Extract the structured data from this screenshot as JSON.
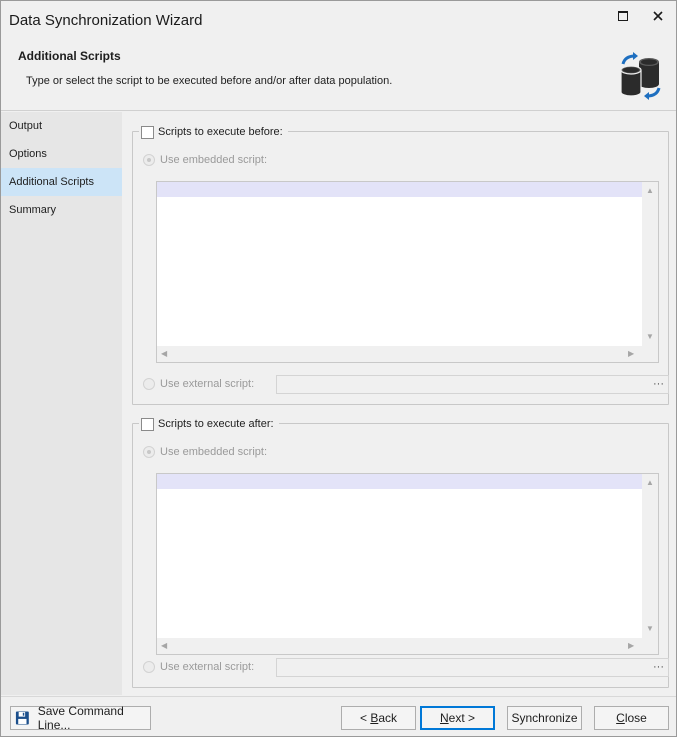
{
  "window": {
    "title": "Data Synchronization Wizard"
  },
  "header": {
    "title": "Additional Scripts",
    "description": "Type or select the script to be executed before and/or after data population."
  },
  "sidebar": {
    "items": [
      {
        "label": "Output",
        "active": false
      },
      {
        "label": "Options",
        "active": false
      },
      {
        "label": "Additional Scripts",
        "active": true
      },
      {
        "label": "Summary",
        "active": false
      }
    ]
  },
  "before_group": {
    "label": "Scripts to execute before:",
    "checked": false,
    "embedded_label": "Use embedded script:",
    "external_label": "Use external script:",
    "external_value": ""
  },
  "after_group": {
    "label": "Scripts to execute after:",
    "checked": false,
    "embedded_label": "Use embedded script:",
    "external_label": "Use external script:",
    "external_value": ""
  },
  "footer": {
    "save_label": "Save Command Line...",
    "back_prefix": "< ",
    "back_key": "B",
    "back_rest": "ack",
    "next_key": "N",
    "next_rest": "ext >",
    "synchronize_label": "Synchronize",
    "close_key": "C",
    "close_rest": "lose"
  },
  "icons": {
    "maximize": "maximize-icon",
    "close": "close-icon",
    "sync": "database-sync-icon",
    "save": "floppy-disk-icon",
    "browse": "ellipsis-icon"
  },
  "colors": {
    "accent": "#0078d7",
    "nav_active": "#cce4f7",
    "editor_highlight": "#e3e3f8",
    "sync_arrow": "#1e6fc0"
  }
}
